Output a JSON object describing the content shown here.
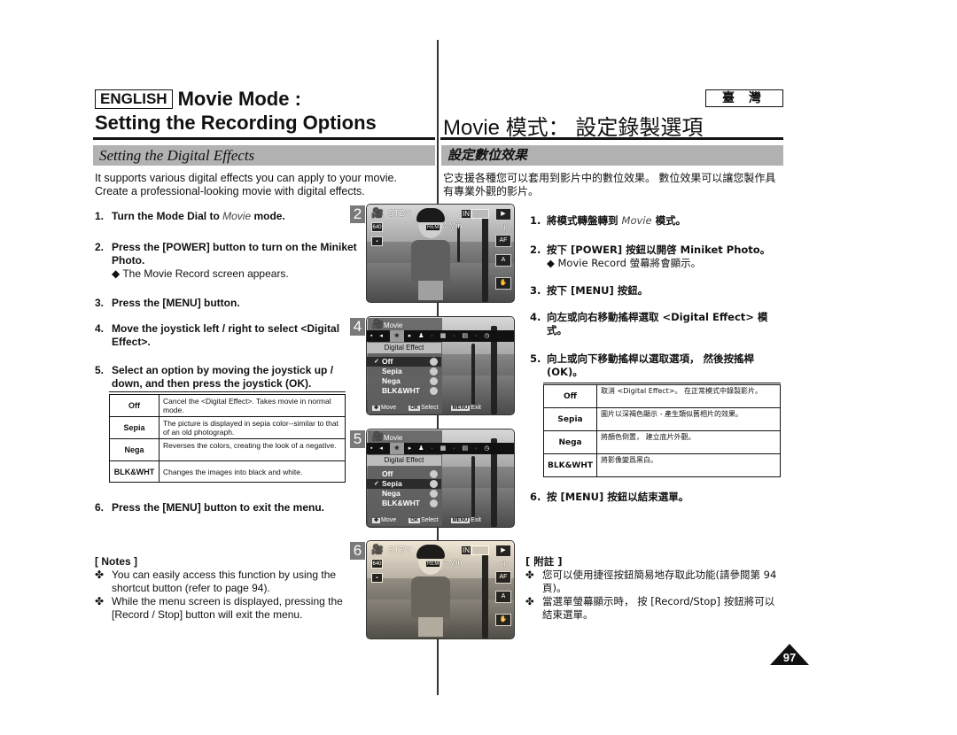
{
  "header": {
    "language_label": "ENGLISH",
    "title_en_line1": "Movie Mode :",
    "title_en_line2": "Setting the Recording Options",
    "region_label": "臺 灣",
    "title_zh": "Movie  模式：  設定錄製選項"
  },
  "section": {
    "en": "Setting the Digital Effects",
    "zh": "設定數位效果"
  },
  "intro": {
    "en": "It supports various digital effects you can apply to your movie. Create a professional-looking movie with digital effects.",
    "zh": "它支援各種您可以套用到影片中的數位效果。 數位效果可以讓您製作具有專業外觀的影片。"
  },
  "steps_en": [
    {
      "num": "1.",
      "text_pre": "Turn the Mode Dial to ",
      "text_em": "Movie",
      "text_post": " mode."
    },
    {
      "num": "2.",
      "text": "Press the [POWER] button to turn on the Miniket Photo.",
      "sub": "◆  The Movie Record screen appears."
    },
    {
      "num": "3.",
      "text": "Press the [MENU] button."
    },
    {
      "num": "4.",
      "text": "Move the joystick left / right to select <Digital Effect>."
    },
    {
      "num": "5.",
      "text": "Select an option by moving the joystick up / down, and then press the joystick (OK)."
    },
    {
      "num": "6.",
      "text": "Press the [MENU] button to exit the menu."
    }
  ],
  "steps_zh": [
    {
      "num": "1.",
      "text_pre": "將模式轉盤轉到 ",
      "text_em": "Movie",
      "text_post": " 模式。"
    },
    {
      "num": "2.",
      "text": "按下 [POWER] 按鈕以開啓 Miniket Photo。",
      "sub": "◆  Movie Record 螢幕將會顯示。"
    },
    {
      "num": "3.",
      "text": "按下 [MENU] 按鈕。"
    },
    {
      "num": "4.",
      "text": "向左或向右移動搖桿選取 <Digital Effect> 模式。"
    },
    {
      "num": "5.",
      "text": "向上或向下移動搖桿以選取選項， 然後按搖桿 (OK)。"
    },
    {
      "num": "6.",
      "text": "按 [MENU] 按鈕以結束選單。"
    }
  ],
  "effects_table_en": [
    {
      "option": "Off",
      "desc": "Cancel the <Digital Effect>. Takes movie in normal mode."
    },
    {
      "option": "Sepia",
      "desc": "The picture is displayed in sepia color--similar to that of an old photograph."
    },
    {
      "option": "Nega",
      "desc": "Reverses the colors, creating the look of a negative."
    },
    {
      "option": "BLK&WHT",
      "desc": "Changes the images into black and white."
    }
  ],
  "effects_table_zh": [
    {
      "option": "Off",
      "desc": "取消 <Digital Effect>。 在正常模式中錄製影片。"
    },
    {
      "option": "Sepia",
      "desc": "圖片以深褐色顯示 - 產生類似舊相片的效果。"
    },
    {
      "option": "Nega",
      "desc": "將顏色倒置， 建立底片外觀。"
    },
    {
      "option": "BLK&WHT",
      "desc": "將影像變爲黑白。"
    }
  ],
  "notes_en": {
    "title": "[ Notes ]",
    "bullet": "✤",
    "items": [
      "You can easily access this function by using the shortcut button (refer to page 94).",
      "While the menu screen is displayed, pressing the [Record / Stop] button will exit the menu."
    ]
  },
  "notes_zh": {
    "title": "[ 附註 ]",
    "bullet": "✤",
    "items": [
      "您可以使用捷徑按鈕簡易地存取此功能(請參閱第 94 頁)。",
      "當選單螢幕顯示時， 按 [Record/Stop] 按鈕將可以結束選單。"
    ]
  },
  "screens": {
    "record": {
      "status": "STBY",
      "resolution": "640",
      "rem_tag": "REM",
      "rem_value": "4 Min",
      "memory": "IN"
    },
    "menu": {
      "mode_title": "Movie",
      "submenu_title": "Digital Effect",
      "options": [
        "Off",
        "Sepia",
        "Nega",
        "BLK&WHT"
      ],
      "footer": {
        "move_key": "✥",
        "move": "Move",
        "select_key": "OK",
        "select": "Select",
        "exit_key": "MENU",
        "exit": "Exit"
      }
    },
    "shots": [
      {
        "label": "2",
        "type": "record"
      },
      {
        "label": "4",
        "type": "menu",
        "selected": "Off"
      },
      {
        "label": "5",
        "type": "menu",
        "selected": "Sepia"
      },
      {
        "label": "6",
        "type": "record"
      }
    ]
  },
  "page_number": "97"
}
